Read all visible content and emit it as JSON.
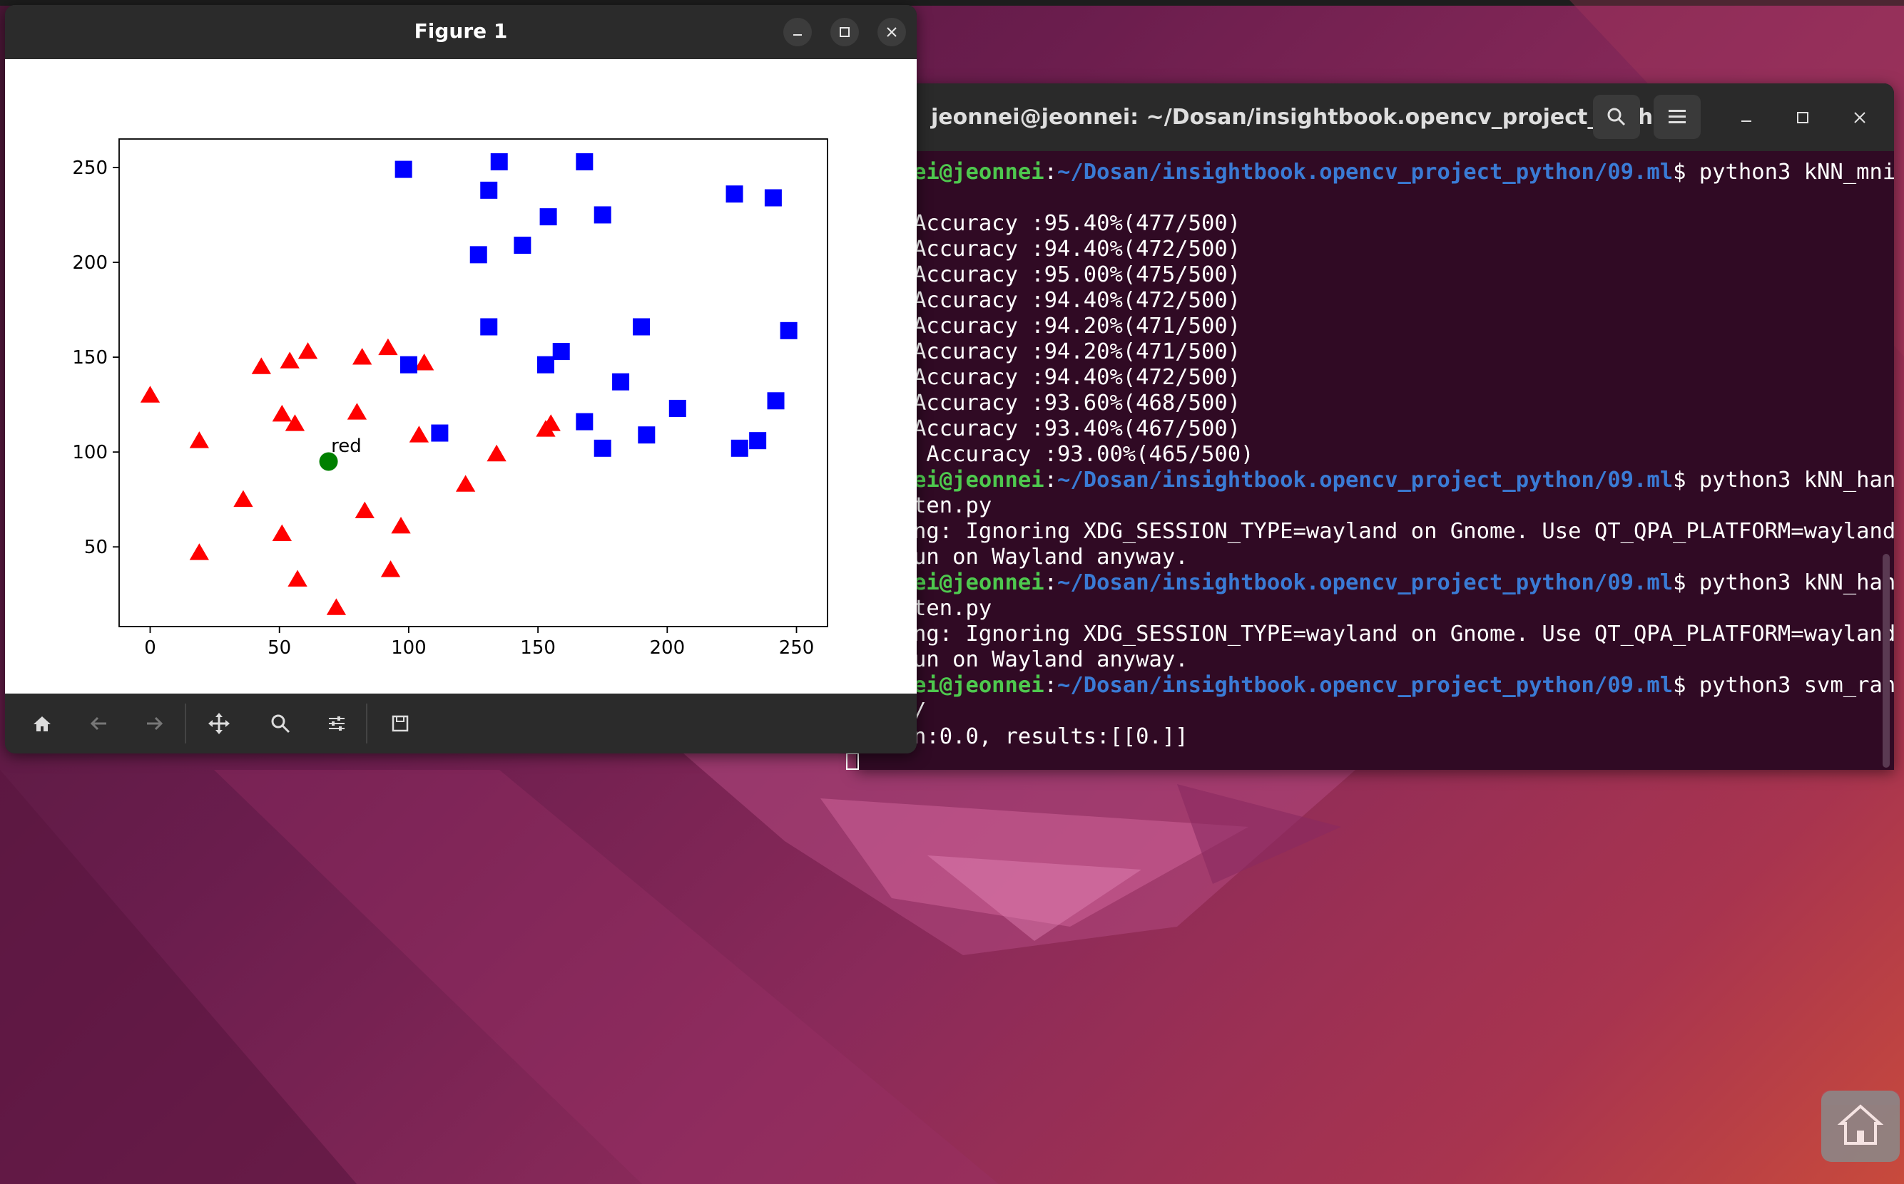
{
  "figure_window": {
    "title": "Figure 1",
    "controls": {
      "minimize": "–",
      "maximize": "□",
      "close": "✕"
    },
    "toolbar": [
      "home-icon",
      "back-icon",
      "forward-icon",
      "pan-icon",
      "zoom-icon",
      "configure-icon",
      "save-icon"
    ]
  },
  "chart_data": {
    "type": "scatter",
    "xlim": [
      -12,
      262
    ],
    "ylim": [
      8,
      265
    ],
    "xticks": [
      0,
      50,
      100,
      150,
      200,
      250
    ],
    "yticks": [
      50,
      100,
      150,
      200,
      250
    ],
    "grid": false,
    "series": [
      {
        "marker": "triangle",
        "color": "#ff0000",
        "points": [
          [
            0,
            130
          ],
          [
            19,
            106
          ],
          [
            19,
            47
          ],
          [
            36,
            75
          ],
          [
            43,
            145
          ],
          [
            51,
            120
          ],
          [
            51,
            57
          ],
          [
            54,
            148
          ],
          [
            56,
            115
          ],
          [
            57,
            33
          ],
          [
            61,
            153
          ],
          [
            72,
            18
          ],
          [
            80,
            121
          ],
          [
            82,
            150
          ],
          [
            83,
            69
          ],
          [
            93,
            38
          ],
          [
            92,
            155
          ],
          [
            97,
            61
          ],
          [
            104,
            109
          ],
          [
            106,
            147
          ],
          [
            122,
            83
          ],
          [
            134,
            99
          ],
          [
            153,
            112
          ],
          [
            155,
            115
          ]
        ]
      },
      {
        "marker": "square",
        "color": "#0000ff",
        "points": [
          [
            98,
            249
          ],
          [
            100,
            146
          ],
          [
            112,
            110
          ],
          [
            127,
            204
          ],
          [
            131,
            238
          ],
          [
            131,
            166
          ],
          [
            135,
            253
          ],
          [
            144,
            209
          ],
          [
            153,
            146
          ],
          [
            154,
            224
          ],
          [
            159,
            153
          ],
          [
            168,
            253
          ],
          [
            168,
            116
          ],
          [
            175,
            225
          ],
          [
            175,
            102
          ],
          [
            182,
            137
          ],
          [
            190,
            166
          ],
          [
            192,
            109
          ],
          [
            204,
            123
          ],
          [
            226,
            236
          ],
          [
            228,
            102
          ],
          [
            235,
            106
          ],
          [
            241,
            234
          ],
          [
            242,
            127
          ],
          [
            247,
            164
          ]
        ]
      },
      {
        "marker": "circle",
        "color": "#008000",
        "points": [
          [
            69,
            95
          ]
        ]
      }
    ],
    "annotations": [
      {
        "text": "red",
        "x": 70,
        "y": 100
      }
    ]
  },
  "terminal": {
    "title": "jeonnei@jeonnei: ~/Dosan/insightbook.opencv_project_pyth...",
    "lines": [
      {
        "parts": [
          {
            "t": "ei@jeonnei",
            "c": "green"
          },
          {
            "t": ":",
            "c": ""
          },
          {
            "t": "~/Dosan/insightbook.opencv_project_python/09.ml",
            "c": "blue"
          },
          {
            "t": "$ python3 kNN_mni",
            "c": ""
          }
        ]
      },
      {
        "parts": [
          {
            "t": "",
            "c": ""
          }
        ]
      },
      {
        "parts": [
          {
            "t": "Accuracy :95.40%(477/500)",
            "c": ""
          }
        ]
      },
      {
        "parts": [
          {
            "t": "Accuracy :94.40%(472/500)",
            "c": ""
          }
        ]
      },
      {
        "parts": [
          {
            "t": "Accuracy :95.00%(475/500)",
            "c": ""
          }
        ]
      },
      {
        "parts": [
          {
            "t": "Accuracy :94.40%(472/500)",
            "c": ""
          }
        ]
      },
      {
        "parts": [
          {
            "t": "Accuracy :94.20%(471/500)",
            "c": ""
          }
        ]
      },
      {
        "parts": [
          {
            "t": "Accuracy :94.20%(471/500)",
            "c": ""
          }
        ]
      },
      {
        "parts": [
          {
            "t": "Accuracy :94.40%(472/500)",
            "c": ""
          }
        ]
      },
      {
        "parts": [
          {
            "t": "Accuracy :93.60%(468/500)",
            "c": ""
          }
        ]
      },
      {
        "parts": [
          {
            "t": "Accuracy :93.40%(467/500)",
            "c": ""
          }
        ]
      },
      {
        "parts": [
          {
            "t": " Accuracy :93.00%(465/500)",
            "c": ""
          }
        ]
      },
      {
        "parts": [
          {
            "t": "ei@jeonnei",
            "c": "green"
          },
          {
            "t": ":",
            "c": ""
          },
          {
            "t": "~/Dosan/insightbook.opencv_project_python/09.ml",
            "c": "blue"
          },
          {
            "t": "$ python3 kNN_han",
            "c": ""
          }
        ]
      },
      {
        "parts": [
          {
            "t": "ten.py",
            "c": ""
          }
        ]
      },
      {
        "parts": [
          {
            "t": "ng: Ignoring XDG_SESSION_TYPE=wayland on Gnome. Use QT_QPA_PLATFORM=wayland",
            "c": ""
          }
        ]
      },
      {
        "parts": [
          {
            "t": "un on Wayland anyway.",
            "c": ""
          }
        ]
      },
      {
        "parts": [
          {
            "t": "ei@jeonnei",
            "c": "green"
          },
          {
            "t": ":",
            "c": ""
          },
          {
            "t": "~/Dosan/insightbook.opencv_project_python/09.ml",
            "c": "blue"
          },
          {
            "t": "$ python3 kNN_han",
            "c": ""
          }
        ]
      },
      {
        "parts": [
          {
            "t": "ten.py",
            "c": ""
          }
        ]
      },
      {
        "parts": [
          {
            "t": "ng: Ignoring XDG_SESSION_TYPE=wayland on Gnome. Use QT_QPA_PLATFORM=wayland",
            "c": ""
          }
        ]
      },
      {
        "parts": [
          {
            "t": "un on Wayland anyway.",
            "c": ""
          }
        ]
      },
      {
        "parts": [
          {
            "t": "ei@jeonnei",
            "c": "green"
          },
          {
            "t": ":",
            "c": ""
          },
          {
            "t": "~/Dosan/insightbook.opencv_project_python/09.ml",
            "c": "blue"
          },
          {
            "t": "$ python3 svm_ran",
            "c": ""
          }
        ]
      },
      {
        "parts": [
          {
            "t": "/",
            "c": ""
          }
        ]
      },
      {
        "parts": [
          {
            "t": "n:0.0, results:[[0.]]",
            "c": ""
          }
        ]
      }
    ]
  },
  "dock": {
    "home_folder": "home-folder-icon"
  }
}
